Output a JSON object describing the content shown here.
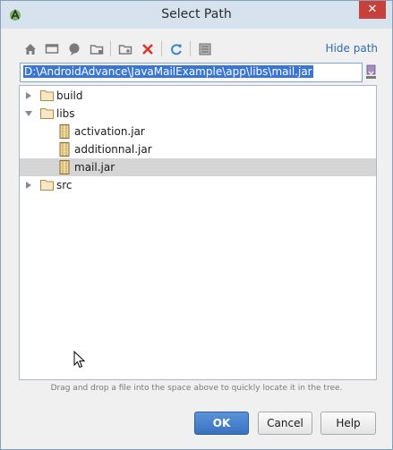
{
  "window": {
    "title": "Select Path",
    "close_glyph": "✕"
  },
  "toolbar": {
    "icons": [
      "home-icon",
      "desktop-icon",
      "project-icon",
      "module-icon",
      "new-folder-icon",
      "delete-icon",
      "refresh-icon",
      "show-hidden-icon"
    ],
    "hide_path_label": "Hide path"
  },
  "path": {
    "value": "D:\\AndroidAdvance\\JavaMailExample\\app\\libs\\mail.jar"
  },
  "tree": {
    "items": [
      {
        "label": "build",
        "type": "folder",
        "expanded": false
      },
      {
        "label": "libs",
        "type": "folder",
        "expanded": true
      },
      {
        "label": "activation.jar",
        "type": "jar"
      },
      {
        "label": "additionnal.jar",
        "type": "jar"
      },
      {
        "label": "mail.jar",
        "type": "jar",
        "selected": true
      },
      {
        "label": "src",
        "type": "folder",
        "expanded": false
      }
    ]
  },
  "hint": "Drag and drop a file into the space above to quickly locate it in the tree.",
  "buttons": {
    "ok": "OK",
    "cancel": "Cancel",
    "help": "Help"
  },
  "colors": {
    "accent": "#3875d7",
    "link": "#2e6bb5",
    "close": "#c7413a"
  }
}
